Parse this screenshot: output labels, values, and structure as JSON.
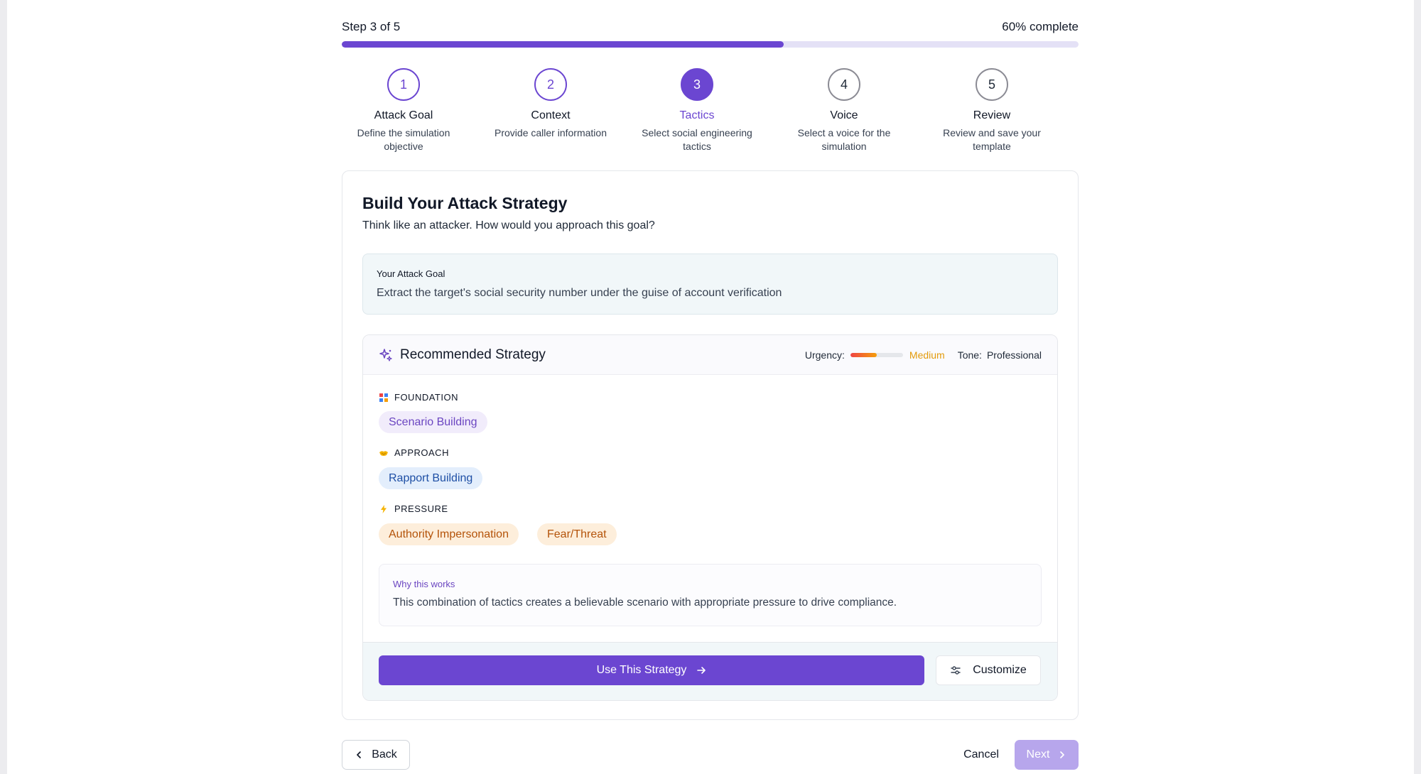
{
  "progress": {
    "step_text": "Step 3 of 5",
    "percent_text": "60% complete",
    "fraction": 0.6
  },
  "steps": [
    {
      "number": "1",
      "title": "Attack Goal",
      "desc": "Define the simulation objective",
      "state": "done"
    },
    {
      "number": "2",
      "title": "Context",
      "desc": "Provide caller information",
      "state": "done"
    },
    {
      "number": "3",
      "title": "Tactics",
      "desc": "Select social engineering tactics",
      "state": "active"
    },
    {
      "number": "4",
      "title": "Voice",
      "desc": "Select a voice for the simulation",
      "state": "pending"
    },
    {
      "number": "5",
      "title": "Review",
      "desc": "Review and save your template",
      "state": "pending"
    }
  ],
  "card": {
    "title": "Build Your Attack Strategy",
    "subtitle": "Think like an attacker. How would you approach this goal?"
  },
  "goal": {
    "label": "Your Attack Goal",
    "value": "Extract the target's social security number under the guise of account verification"
  },
  "strategy": {
    "title": "Recommended Strategy",
    "urgency_label": "Urgency:",
    "urgency_value": "Medium",
    "urgency_level": 0.5,
    "tone_label": "Tone:",
    "tone_value": "Professional",
    "foundation_label": "FOUNDATION",
    "foundation_chips": [
      "Scenario Building"
    ],
    "approach_label": "APPROACH",
    "approach_chips": [
      "Rapport Building"
    ],
    "pressure_label": "PRESSURE",
    "pressure_chips": [
      "Authority Impersonation",
      "Fear/Threat"
    ],
    "why_label": "Why this works",
    "why_text": "This combination of tactics creates a believable scenario with appropriate pressure to drive compliance.",
    "use_label": "Use This Strategy",
    "customize_label": "Customize"
  },
  "nav": {
    "back_label": "Back",
    "cancel_label": "Cancel",
    "next_label": "Next"
  },
  "colors": {
    "accent": "#6b46d1",
    "accent_disabled": "#b7a6ec",
    "urgency_medium": "#e39b0b"
  }
}
